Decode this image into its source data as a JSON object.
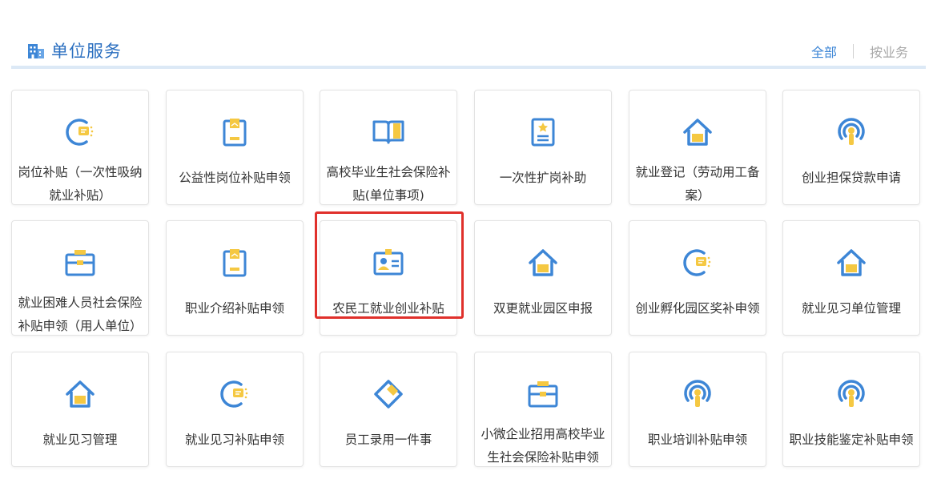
{
  "header": {
    "title": "单位服务",
    "filter_all": "全部",
    "filter_business": "按业务"
  },
  "colors": {
    "accent_blue": "#2b6fc0",
    "icon_blue": "#3d86d6",
    "icon_yellow": "#f5c842",
    "highlight_red": "#e0302b"
  },
  "services": [
    {
      "label": "岗位补贴（一次性吸纳就业补贴）",
      "icon": "coin-c-icon"
    },
    {
      "label": "公益性岗位补贴申领",
      "icon": "document-icon"
    },
    {
      "label": "高校毕业生社会保险补贴(单位事项)",
      "icon": "book-icon"
    },
    {
      "label": "一次性扩岗补助",
      "icon": "certificate-icon"
    },
    {
      "label": "就业登记（劳动用工备案）",
      "icon": "house-icon"
    },
    {
      "label": "创业担保贷款申请",
      "icon": "signal-icon"
    },
    {
      "label": "就业困难人员社会保险补贴申领（用人单位）",
      "icon": "briefcase-icon"
    },
    {
      "label": "职业介绍补贴申领",
      "icon": "document-icon"
    },
    {
      "label": "农民工就业创业补贴",
      "icon": "id-card-icon"
    },
    {
      "label": "双更就业园区申报",
      "icon": "house-icon"
    },
    {
      "label": "创业孵化园区奖补申领",
      "icon": "coin-c-icon"
    },
    {
      "label": "就业见习单位管理",
      "icon": "house-icon"
    },
    {
      "label": "就业见习管理",
      "icon": "house-icon"
    },
    {
      "label": "就业见习补贴申领",
      "icon": "coin-c-icon"
    },
    {
      "label": "员工录用一件事",
      "icon": "diamond-tag-icon"
    },
    {
      "label": "小微企业招用高校毕业生社会保险补贴申领",
      "icon": "briefcase-icon"
    },
    {
      "label": "职业培训补贴申领",
      "icon": "signal-icon"
    },
    {
      "label": "职业技能鉴定补贴申领",
      "icon": "signal-icon"
    }
  ]
}
